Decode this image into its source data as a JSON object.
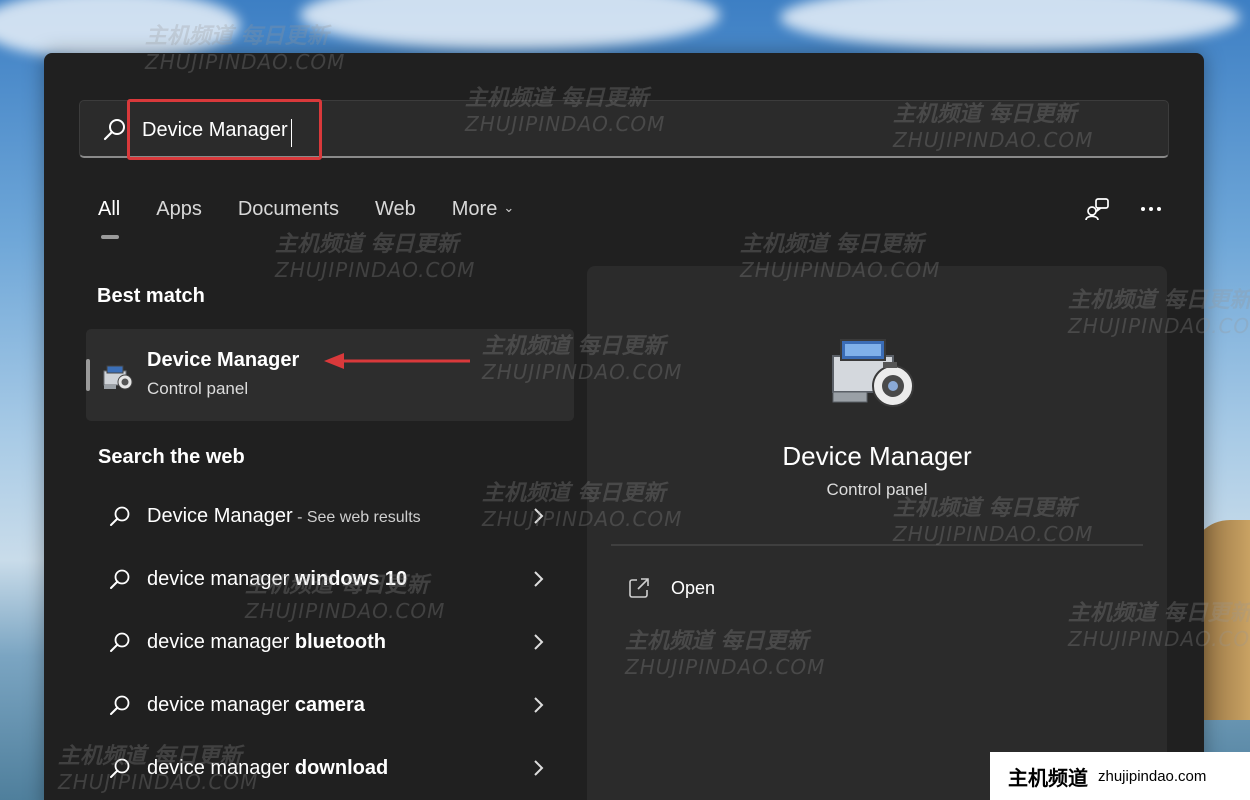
{
  "search": {
    "value": "Device Manager",
    "placeholder": ""
  },
  "tabs": [
    {
      "label": "All",
      "active": true
    },
    {
      "label": "Apps"
    },
    {
      "label": "Documents"
    },
    {
      "label": "Web"
    },
    {
      "label": "More"
    }
  ],
  "top_icons": [
    "feedback-icon",
    "more-options-icon"
  ],
  "best_match": {
    "heading": "Best match",
    "title": "Device Manager",
    "subtitle": "Control panel"
  },
  "web": {
    "heading": "Search the web",
    "results": [
      {
        "prefix": "Device Manager",
        "bold": "",
        "suffix": " - See web results"
      },
      {
        "prefix": "device manager ",
        "bold": "windows 10",
        "suffix": ""
      },
      {
        "prefix": "device manager ",
        "bold": "bluetooth",
        "suffix": ""
      },
      {
        "prefix": "device manager ",
        "bold": "camera",
        "suffix": ""
      },
      {
        "prefix": "device manager ",
        "bold": "download",
        "suffix": ""
      }
    ]
  },
  "preview": {
    "title": "Device Manager",
    "subtitle": "Control panel",
    "actions": [
      {
        "label": "Open",
        "icon": "open-external-icon"
      }
    ]
  },
  "watermark": {
    "cn": "主机频道 每日更新",
    "en": "ZHUJIPINDAO.COM"
  },
  "badge": {
    "cn": "主机频道",
    "en": "zhujipindao.com"
  },
  "colors": {
    "panel": "#202020",
    "highlight": "#d9393b",
    "annotation_arrow": "#d9393b"
  }
}
